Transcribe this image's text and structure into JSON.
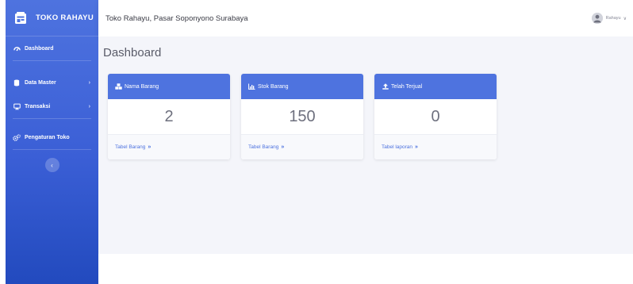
{
  "sidebar": {
    "brand": "TOKO RAHAYU",
    "items": [
      {
        "label": "Dashboard",
        "icon": "tachometer-icon"
      },
      {
        "label": "Data Master",
        "icon": "database-icon",
        "chevron": "›"
      },
      {
        "label": "Transaksi",
        "icon": "desktop-icon",
        "chevron": "›"
      },
      {
        "label": "Pengaturan Toko",
        "icon": "cogs-icon"
      }
    ],
    "toggle_glyph": "‹"
  },
  "topbar": {
    "title": "Toko Rahayu, Pasar Soponyono Surabaya",
    "user_name": "Rahayu",
    "user_chevron": "∨"
  },
  "main": {
    "page_title": "Dashboard",
    "cards": [
      {
        "title": "Nama Barang",
        "icon": "cubes-icon",
        "value": "2",
        "link": "Tabel Barang",
        "arrow": "»"
      },
      {
        "title": "Stok Barang",
        "icon": "chart-bar-icon",
        "value": "150",
        "link": "Tabel Barang",
        "arrow": "»"
      },
      {
        "title": "Telah Terjual",
        "icon": "upload-icon",
        "value": "0",
        "link": "Tabel laporan",
        "arrow": "»"
      }
    ]
  },
  "colors": {
    "primary": "#4e73df",
    "sidebar_bottom": "#224abe",
    "content_bg": "#f4f5fa",
    "text_dark": "#3a3b45"
  }
}
